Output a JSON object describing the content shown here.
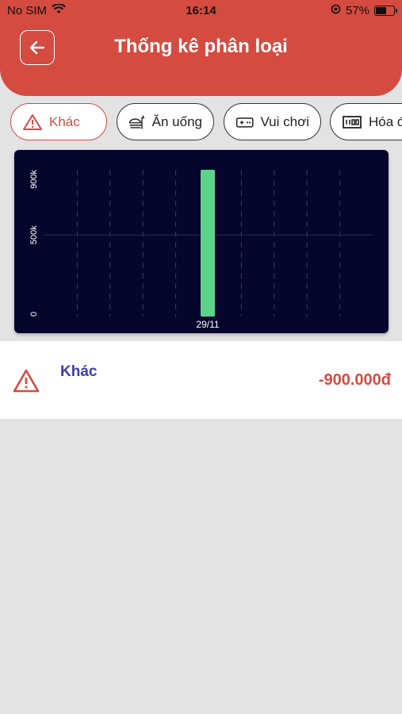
{
  "status_bar": {
    "carrier": "No SIM",
    "time": "16:14",
    "battery": "57%"
  },
  "header": {
    "title": "Thống kê phân loại"
  },
  "categories": [
    {
      "label": "Khác",
      "icon": "warning-icon",
      "active": true
    },
    {
      "label": "Ăn uống",
      "icon": "food-icon",
      "active": false
    },
    {
      "label": "Vui chơi",
      "icon": "gamepad-icon",
      "active": false
    },
    {
      "label": "Hóa đ",
      "icon": "bill-icon",
      "active": false
    }
  ],
  "chart_data": {
    "type": "bar",
    "categories": [
      "29/11"
    ],
    "values": [
      900000
    ],
    "ylim": [
      0,
      900000
    ],
    "yticks": [
      {
        "value": 0,
        "label": "0"
      },
      {
        "value": 500000,
        "label": "500k"
      },
      {
        "value": 900000,
        "label": "900k"
      }
    ],
    "colors": {
      "bar": "#5bd38a",
      "background": "#06062c"
    }
  },
  "transactions": [
    {
      "name": "Khác",
      "amount": "-900.000đ",
      "icon": "warning-icon"
    }
  ],
  "colors": {
    "primary": "#d54b40",
    "name_text": "#3e3bb1"
  }
}
